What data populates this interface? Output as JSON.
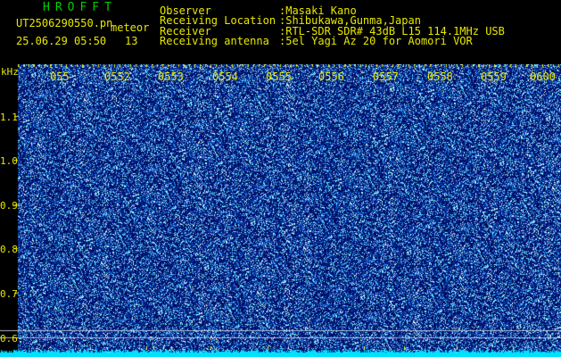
{
  "header": {
    "brand": "HROFFT",
    "filename": "UT2506290550.pn",
    "mode": "meteor",
    "datetime": "25.06.29 05:50",
    "count": "13",
    "fields": [
      {
        "label": "Observer",
        "value": ":Masaki Kano"
      },
      {
        "label": "Receiving Location",
        "value": ":Shibukawa,Gunma,Japan"
      },
      {
        "label": "Receiver",
        "value": ":RTL-SDR SDR# 43dB L15 114.1MHz USB"
      },
      {
        "label": "Receiving antenna",
        "value": ":5el Yagi Az 20 for Aomori VOR"
      }
    ]
  },
  "axis": {
    "y_unit": "kHz",
    "y_ticks": [
      "1.1",
      "1.0",
      "0.9",
      "0.8",
      "0.7",
      "0.6"
    ],
    "x_ticks": [
      "055",
      "0552",
      "0553",
      "0554",
      "0555",
      "0556",
      "0557",
      "0558",
      "0559",
      "0600"
    ]
  },
  "colors": {
    "text": "#e8e800",
    "brand": "#00d000",
    "background": "#000000",
    "noise_base": "#10189a",
    "baseline": "#00e0ff"
  }
}
